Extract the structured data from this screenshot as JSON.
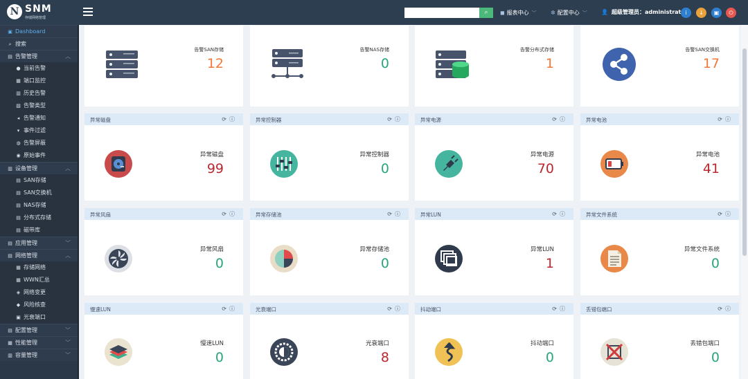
{
  "header": {
    "logo_letter": "N",
    "logo_title": "SNM",
    "logo_subtitle": "存储网络管理",
    "search_placeholder": "",
    "menus": [
      {
        "icon": "chart-icon",
        "label": "报表中心"
      },
      {
        "icon": "gear-icon",
        "label": "配置中心"
      }
    ],
    "user_label": "超级管理员：administrator",
    "action_buttons": [
      {
        "icon": "info-icon",
        "color": "#2f7fd1"
      },
      {
        "icon": "download-icon",
        "color": "#e9a23b"
      },
      {
        "icon": "lock-icon",
        "color": "#2f7fd1"
      },
      {
        "icon": "power-icon",
        "color": "#e8574f"
      }
    ]
  },
  "sidebar": {
    "items": [
      {
        "label": "Dashboard",
        "icon": "dashboard-icon",
        "kind": "group",
        "active": true,
        "chev": ""
      },
      {
        "label": "搜索",
        "icon": "search-icon",
        "kind": "group",
        "active": false,
        "chev": ""
      },
      {
        "label": "告警管理",
        "icon": "alarm-icon",
        "kind": "group",
        "active": false,
        "chev": "︿"
      },
      {
        "label": "当前告警",
        "icon": "alert-icon",
        "kind": "sub",
        "active": false,
        "chev": ""
      },
      {
        "label": "端口监控",
        "icon": "port-icon",
        "kind": "sub",
        "active": false,
        "chev": ""
      },
      {
        "label": "历史告警",
        "icon": "history-icon",
        "kind": "sub",
        "active": false,
        "chev": ""
      },
      {
        "label": "告警类型",
        "icon": "type-icon",
        "kind": "sub",
        "active": false,
        "chev": ""
      },
      {
        "label": "告警通知",
        "icon": "notify-icon",
        "kind": "sub",
        "active": false,
        "chev": ""
      },
      {
        "label": "事件过滤",
        "icon": "filter-icon",
        "kind": "sub",
        "active": false,
        "chev": ""
      },
      {
        "label": "告警屏蔽",
        "icon": "shield-icon",
        "kind": "sub",
        "active": false,
        "chev": ""
      },
      {
        "label": "原始事件",
        "icon": "event-icon",
        "kind": "sub",
        "active": false,
        "chev": ""
      },
      {
        "label": "设备管理",
        "icon": "device-icon",
        "kind": "group",
        "active": false,
        "chev": "︿"
      },
      {
        "label": "SAN存储",
        "icon": "storage-icon",
        "kind": "sub",
        "active": false,
        "chev": ""
      },
      {
        "label": "SAN交换机",
        "icon": "switch-icon",
        "kind": "sub",
        "active": false,
        "chev": ""
      },
      {
        "label": "NAS存储",
        "icon": "nas-icon",
        "kind": "sub",
        "active": false,
        "chev": ""
      },
      {
        "label": "分布式存储",
        "icon": "distributed-icon",
        "kind": "sub",
        "active": false,
        "chev": ""
      },
      {
        "label": "磁带库",
        "icon": "tape-icon",
        "kind": "sub",
        "active": false,
        "chev": ""
      },
      {
        "label": "应用管理",
        "icon": "app-icon",
        "kind": "group",
        "active": false,
        "chev": "﹀"
      },
      {
        "label": "网络管理",
        "icon": "network-icon",
        "kind": "group",
        "active": false,
        "chev": "︿"
      },
      {
        "label": "存储网络",
        "icon": "storage-network-icon",
        "kind": "sub",
        "active": false,
        "chev": ""
      },
      {
        "label": "WWN汇总",
        "icon": "wwn-icon",
        "kind": "sub",
        "active": false,
        "chev": ""
      },
      {
        "label": "网络变更",
        "icon": "change-icon",
        "kind": "sub",
        "active": false,
        "chev": ""
      },
      {
        "label": "风险核查",
        "icon": "risk-icon",
        "kind": "sub",
        "active": false,
        "chev": ""
      },
      {
        "label": "光衰端口",
        "icon": "optical-icon",
        "kind": "sub",
        "active": false,
        "chev": ""
      },
      {
        "label": "配置管理",
        "icon": "config-icon",
        "kind": "group",
        "active": false,
        "chev": "﹀"
      },
      {
        "label": "性能管理",
        "icon": "performance-icon",
        "kind": "group",
        "active": false,
        "chev": "﹀"
      },
      {
        "label": "容量管理",
        "icon": "capacity-icon",
        "kind": "group",
        "active": false,
        "chev": "﹀"
      }
    ]
  },
  "cards": [
    {
      "header": "",
      "label": "告警SAN存储",
      "value": "12",
      "value_color": "orange",
      "icon": "san-storage-icon"
    },
    {
      "header": "",
      "label": "告警NAS存储",
      "value": "0",
      "value_color": "green",
      "icon": "nas-storage-icon"
    },
    {
      "header": "",
      "label": "告警分布式存储",
      "value": "1",
      "value_color": "orange",
      "icon": "distributed-storage-icon"
    },
    {
      "header": "",
      "label": "告警SAN交换机",
      "value": "17",
      "value_color": "orange",
      "icon": "share-icon"
    },
    {
      "header": "异常磁盘",
      "label": "异常磁盘",
      "value": "99",
      "value_color": "red",
      "icon": "disk-icon"
    },
    {
      "header": "异常控制器",
      "label": "异常控制器",
      "value": "0",
      "value_color": "green",
      "icon": "controller-icon"
    },
    {
      "header": "异常电源",
      "label": "异常电源",
      "value": "70",
      "value_color": "red",
      "icon": "power-plug-icon"
    },
    {
      "header": "异常电池",
      "label": "异常电池",
      "value": "41",
      "value_color": "red",
      "icon": "battery-icon"
    },
    {
      "header": "异常风扇",
      "label": "异常风扇",
      "value": "0",
      "value_color": "green",
      "icon": "fan-icon"
    },
    {
      "header": "异常存储池",
      "label": "异常存储池",
      "value": "0",
      "value_color": "green",
      "icon": "pie-icon"
    },
    {
      "header": "异常LUN",
      "label": "异常LUN",
      "value": "1",
      "value_color": "red",
      "icon": "lun-icon"
    },
    {
      "header": "异常文件系统",
      "label": "异常文件系统",
      "value": "0",
      "value_color": "green",
      "icon": "file-icon"
    },
    {
      "header": "慢速LUN",
      "label": "慢速LUN",
      "value": "0",
      "value_color": "green",
      "icon": "layers-icon"
    },
    {
      "header": "光衰端口",
      "label": "光衰端口",
      "value": "8",
      "value_color": "red",
      "icon": "optical-port-icon"
    },
    {
      "header": "抖动端口",
      "label": "抖动端口",
      "value": "0",
      "value_color": "green",
      "icon": "jitter-icon"
    },
    {
      "header": "丢错包端口",
      "label": "丢错包端口",
      "value": "0",
      "value_color": "green",
      "icon": "packet-loss-icon"
    }
  ]
}
